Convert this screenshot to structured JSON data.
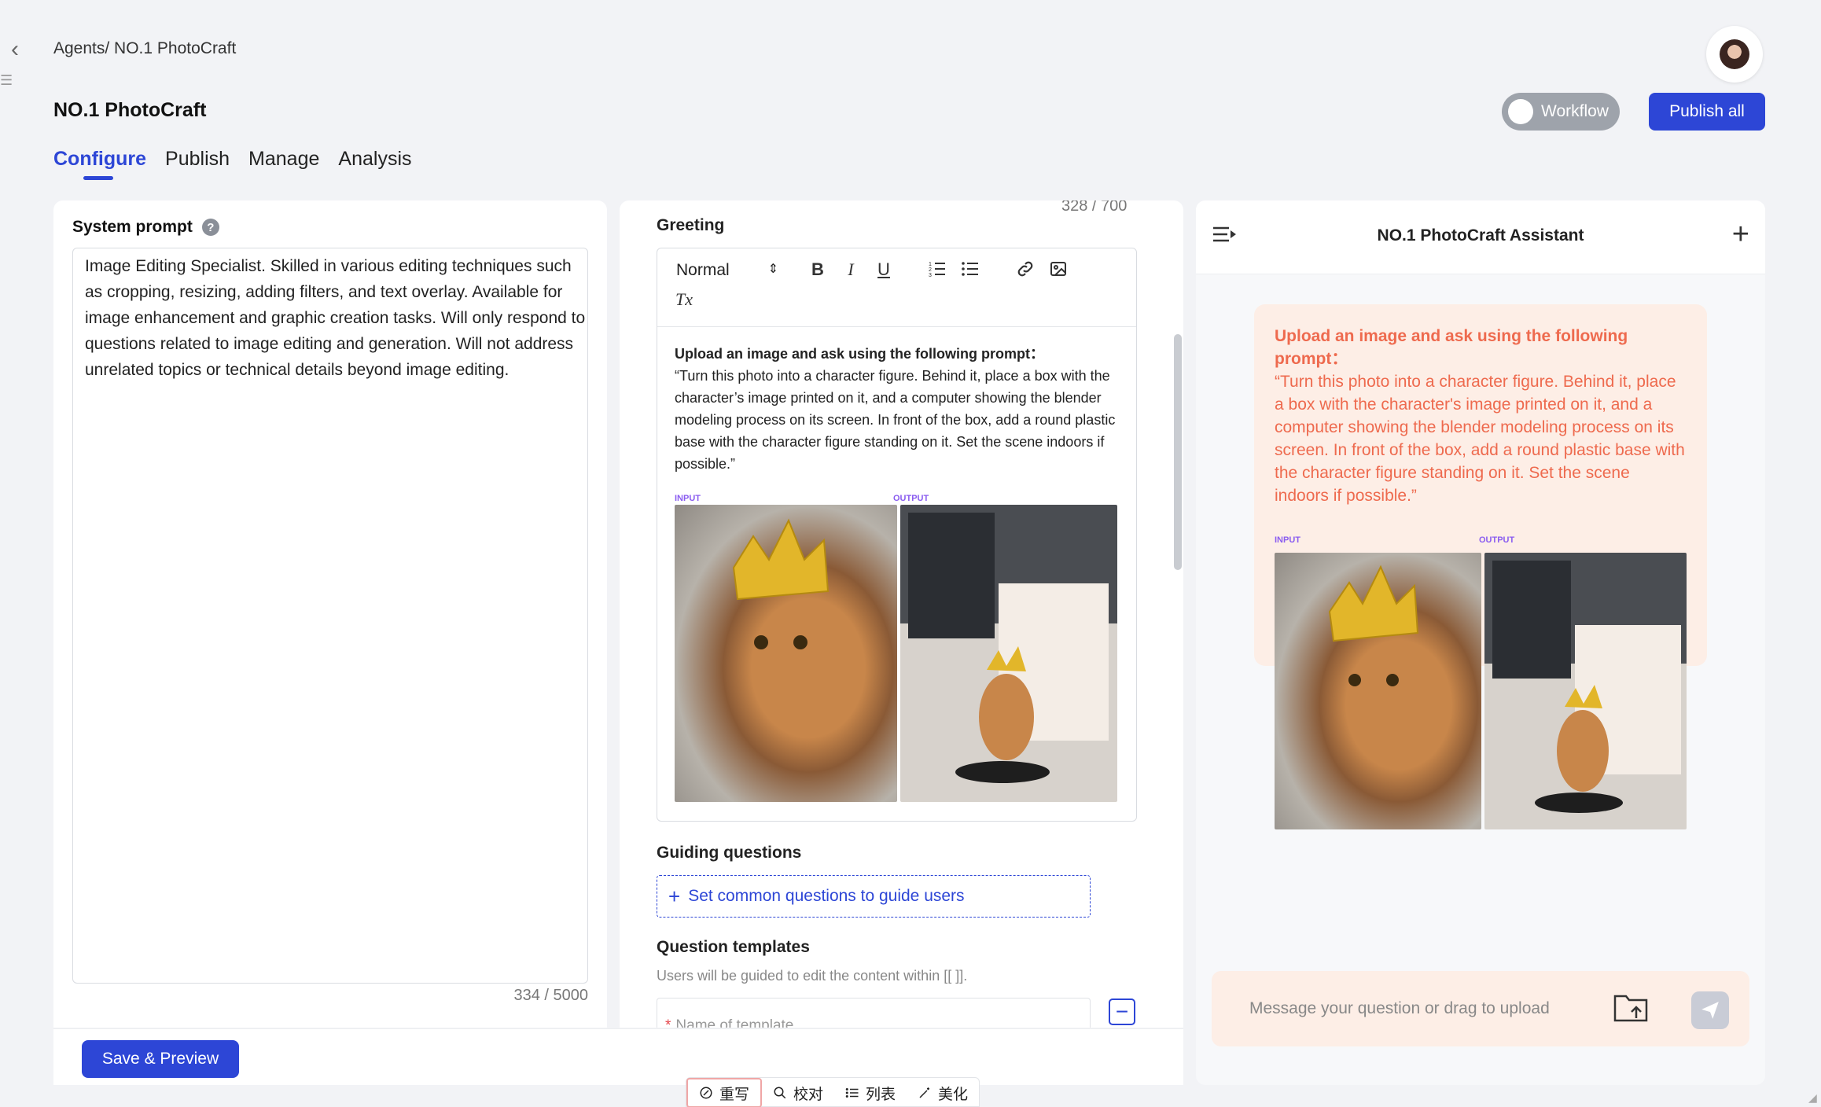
{
  "breadcrumb": "Agents/ NO.1 PhotoCraft",
  "header": {
    "title": "NO.1 PhotoCraft",
    "workflow_label": "Workflow",
    "publish_all_label": "Publish all"
  },
  "tabs": [
    {
      "label": "Configure",
      "active": true
    },
    {
      "label": "Publish",
      "active": false
    },
    {
      "label": "Manage",
      "active": false
    },
    {
      "label": "Analysis",
      "active": false
    }
  ],
  "system_prompt": {
    "label": "System prompt",
    "help_glyph": "?",
    "value": "Image Editing Specialist. Skilled in various editing techniques such as cropping, resizing, adding filters, and text overlay. Available for image enhancement and graphic creation tasks. Will only respond to questions related to image editing and generation. Will not address unrelated topics or technical details beyond image editing.",
    "count": "334 / 5000"
  },
  "greeting": {
    "label": "Greeting",
    "count": "328 / 700",
    "toolbar": {
      "format": "Normal",
      "bold": "B",
      "italic": "I",
      "underline": "U",
      "clear_format": "Tx"
    },
    "lead": "Upload an image and ask using the following prompt：",
    "body": "“Turn this photo into a character figure. Behind it, place a box with the character’s image printed on it, and a computer showing the blender modeling process on its screen. In front of the box, add a round plastic base with the character figure standing on it. Set the scene indoors if possible.”",
    "input_label": "INPUT",
    "output_label": "OUTPUT"
  },
  "guiding_questions": {
    "label": "Guiding questions",
    "button_label": "Set common questions to guide users"
  },
  "question_templates": {
    "label": "Question templates",
    "hint": "Users will be guided to edit the content within [[ ]].",
    "name_placeholder": "Name of template",
    "required_mark": "*"
  },
  "bottom": {
    "save_label": "Save & Preview",
    "ai_tools": [
      {
        "label": "重写"
      },
      {
        "label": "校对"
      },
      {
        "label": "列表"
      },
      {
        "label": "美化"
      }
    ]
  },
  "assistant": {
    "title": "NO.1 PhotoCraft Assistant",
    "message_lead": "Upload an image and ask using the following prompt：",
    "message_body": "“Turn this photo into a character figure. Behind it, place a box with the character's image printed on it, and a computer showing the blender modeling process on its screen. In front of the box, add a round plastic base with the character figure standing on it. Set the scene indoors if possible.”",
    "input_label": "INPUT",
    "output_label": "OUTPUT",
    "input_placeholder": "Message your question or drag to upload"
  },
  "colors": {
    "accent": "#2d46d6",
    "bubble_bg": "#fdeee6",
    "bubble_text": "#ee6a4e"
  }
}
